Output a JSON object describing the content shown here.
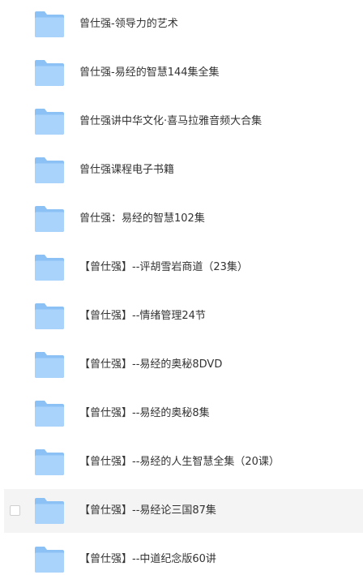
{
  "colors": {
    "folder_back": "#8cc1f5",
    "folder_front": "#a9d3fb",
    "text": "#333333",
    "hover_bg": "#f4f4f4"
  },
  "files": [
    {
      "name": "曾仕强-领导力的艺术",
      "icon": "folder-icon"
    },
    {
      "name": "曾仕强-易经的智慧144集全集",
      "icon": "folder-icon"
    },
    {
      "name": "曾仕强讲中华文化·喜马拉雅音频大合集",
      "icon": "folder-icon"
    },
    {
      "name": "曾仕强课程电子书籍",
      "icon": "folder-icon"
    },
    {
      "name": "曾仕强：易经的智慧102集",
      "icon": "folder-icon"
    },
    {
      "name": "【曾仕强】--评胡雪岩商道（23集）",
      "icon": "folder-icon"
    },
    {
      "name": "【曾仕强】--情绪管理24节",
      "icon": "folder-icon"
    },
    {
      "name": "【曾仕强】--易经的奥秘8DVD",
      "icon": "folder-icon"
    },
    {
      "name": "【曾仕强】--易经的奥秘8集",
      "icon": "folder-icon"
    },
    {
      "name": "【曾仕强】--易经的人生智慧全集（20课）",
      "icon": "folder-icon"
    },
    {
      "name": "【曾仕强】--易经论三国87集",
      "icon": "folder-icon",
      "hovered": true
    },
    {
      "name": "【曾仕强】--中道纪念版60讲",
      "icon": "folder-icon"
    }
  ]
}
